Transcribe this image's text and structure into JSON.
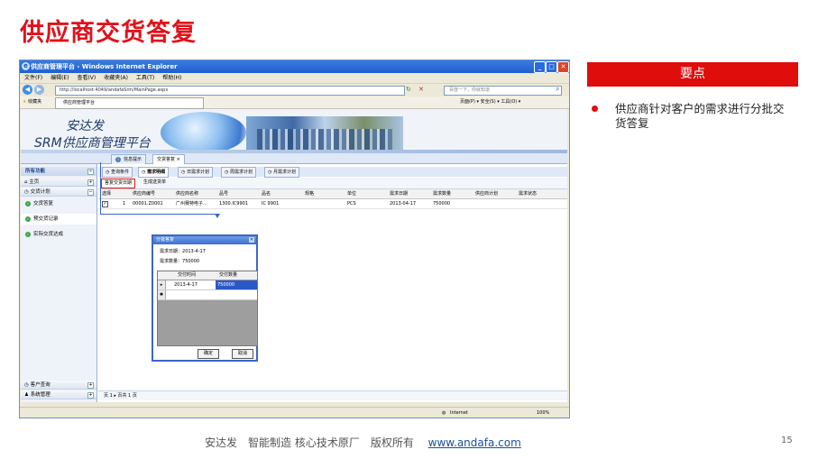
{
  "slide": {
    "title": "供应商交货答复",
    "panel_title": "要点",
    "bullet": "供应商针对客户的需求进行分批交货答复",
    "footer_text": "安达发　智能制造 核心技术原厂　版权所有",
    "footer_link": "www.andafa.com",
    "page_number": "15"
  },
  "browser": {
    "window_title": "供应商管理平台 - Windows Internet Explorer",
    "menu": [
      "文件(F)",
      "编辑(E)",
      "查看(V)",
      "收藏夹(A)",
      "工具(T)",
      "帮助(H)"
    ],
    "address": "http://localhost:4049/andafaSrm/MainPage.aspx",
    "search_placeholder": "百度一下，你就知道",
    "favorites_label": "收藏夹",
    "tab_title": "供应商管理平台",
    "toolbar_right": "页面(P) ▾  安全(S) ▾  工具(O) ▾",
    "status_zone": "Internet",
    "zoom": "100%"
  },
  "app": {
    "banner_line1": "安达发",
    "banner_line2": "SRM供应商管理平台",
    "top_tabs": [
      "信息提示",
      "交货答复"
    ],
    "sidebar": {
      "header": "所有功能",
      "sections": [
        "主页",
        "交货计划"
      ],
      "items": [
        "交货答复",
        "预交货记录",
        "实际交货达成"
      ],
      "bottom_sections": [
        "客户查询",
        "系统管理"
      ]
    },
    "sub_tabs": [
      "查询条件",
      "需求明细",
      "日需求计划",
      "周需求计划",
      "月需求计划"
    ],
    "toolbar_buttons": [
      "答复交货日期",
      "生成送货单"
    ],
    "grid": {
      "headers": [
        "选择",
        "供应商编号",
        "供应商名称",
        "品号",
        "品名",
        "规格",
        "单位",
        "需求日期",
        "需求数量",
        "供应商计划",
        "需求状态"
      ],
      "row": {
        "checked": "✓",
        "index": "1",
        "supplier_code": "00001.Z0001",
        "supplier_name": "广州赛特电子…",
        "part_no": "1300.IC9901",
        "part_name": "IC 9901",
        "spec": "",
        "unit": "PCS",
        "demand_date": "2013-04-17",
        "demand_qty": "750000"
      }
    },
    "pager": "页 1 ▸  页共 1 页"
  },
  "dialog": {
    "title": "分批答复",
    "demand_date_label": "需求日期：",
    "demand_date_value": "2013-4-17",
    "demand_qty_label": "需求数量：",
    "demand_qty_value": "750000",
    "col_time": "交付时间",
    "col_qty": "交付数量",
    "row1_time": "2013-4-17",
    "row1_qty": "750000",
    "ok": "确定",
    "cancel": "取消"
  }
}
